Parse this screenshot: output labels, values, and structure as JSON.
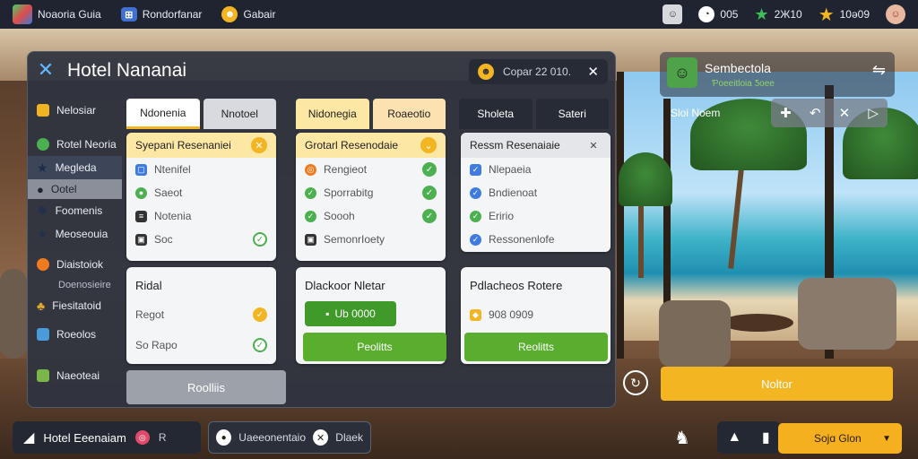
{
  "topbar": {
    "tabs": [
      {
        "label": "Noaoria Guia",
        "icon": "cube-icon"
      },
      {
        "label": "Rondorfanar",
        "icon": "id-card-icon"
      },
      {
        "label": "Gabair",
        "icon": "coin-icon"
      }
    ],
    "resources": [
      {
        "value": "",
        "icon": "character-icon"
      },
      {
        "value": "005",
        "icon": "clock-icon"
      },
      {
        "value": "2Ж10",
        "icon": "star-icon"
      },
      {
        "value": "10ǝ09",
        "icon": "gold-star-icon"
      }
    ]
  },
  "panel": {
    "title": "Hotel Nananai",
    "coin_label": "Copar 22 010.",
    "sidebar": [
      {
        "label": "Nelosiar",
        "icon": "house-icon",
        "color": "#f0b322"
      },
      {
        "label": "Rotel Neoria",
        "icon": "leaf-icon",
        "color": "#4caf50"
      },
      {
        "label": "Megleda",
        "icon": "star-icon",
        "color": "#2f4e7a"
      },
      {
        "label": "Ootel",
        "icon": "person-icon",
        "color": "#4a4f59"
      },
      {
        "label": "Foomenis",
        "icon": "gear-icon",
        "color": "#3a4d6e"
      },
      {
        "label": "Meoseouia",
        "icon": "star-icon",
        "color": "#3a4d6e"
      },
      {
        "label": "Diaistoiok",
        "icon": "orb-icon",
        "color": "#f07b1f"
      },
      {
        "label": "Doenosieire",
        "icon": "",
        "color": ""
      },
      {
        "label": "Fiesitatoid",
        "icon": "tree-icon",
        "color": "#e0a92e"
      },
      {
        "label": "Roeolos",
        "icon": "grid-icon",
        "color": "#4a9bd9"
      },
      {
        "label": "Naeoteai",
        "icon": "cash-icon",
        "color": "#7ab648"
      }
    ],
    "columns": [
      {
        "tabs": [
          "Ndonenia",
          "Nnotoel"
        ],
        "card_title": "Syepani Resenaniei",
        "rows": [
          {
            "label": "Ntenifel",
            "lead": "box-icon",
            "check": false
          },
          {
            "label": "Saeot",
            "lead": "chat-icon",
            "check": false
          },
          {
            "label": "Notenia",
            "lead": "list-icon",
            "check": false
          },
          {
            "label": "Soc",
            "lead": "cup-icon",
            "check": true
          }
        ],
        "lower_title": "Ridal",
        "lower_rows": [
          {
            "label": "Regot"
          },
          {
            "label": "So Rapo"
          }
        ],
        "button": "Roolliis"
      },
      {
        "tabs": [
          "Nidonegia",
          "Roaeotio"
        ],
        "card_title": "Grotarl Resenodaie",
        "rows": [
          {
            "label": "Rengieot",
            "lead": "target-icon",
            "check": true
          },
          {
            "label": "Sporrabitg",
            "lead": "check-icon",
            "check": true
          },
          {
            "label": "Soooh",
            "lead": "check-icon",
            "check": true
          },
          {
            "label": "SemonrIoety",
            "lead": "cup-icon",
            "check": false
          }
        ],
        "lower_title": "Dlackoor Nletar",
        "chip_value": "Ub 0000",
        "button": "Peolitts"
      },
      {
        "tabs": [
          "Sholeta",
          "Sateri"
        ],
        "card_title": "Ressm Resenaiaie",
        "rows": [
          {
            "label": "Nlepaeia",
            "lead": "check-box-icon"
          },
          {
            "label": "Bndienoat",
            "lead": "check-circle-icon"
          },
          {
            "label": "Eririo",
            "lead": "check-circle-icon"
          },
          {
            "label": "Ressonenlofe",
            "lead": "check-circle-icon"
          }
        ],
        "lower_title": "Pdlacheos Rotere",
        "price": "908 0909",
        "button": "Reolitts"
      }
    ]
  },
  "profile": {
    "name": "Sembectola",
    "sub": "Ƥoeeitloia Ƽoee",
    "label": "Sloi Noem"
  },
  "action_button": "Noltor",
  "bottombar": {
    "title": "Hotel Eeenaiam",
    "badge": "R",
    "search_label": "Uaeeonentaio",
    "search_extra": "Dlaek",
    "gold_label": "Sojɑ Glon"
  },
  "colors": {
    "accent_yellow": "#f3b522",
    "accent_green": "#5aae2e",
    "panel_bg": "#2e3440"
  }
}
